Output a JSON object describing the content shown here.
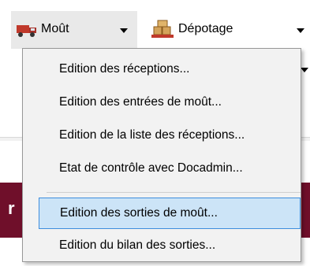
{
  "toolbar": {
    "mout": {
      "label": "Moût",
      "icon": "truck-icon"
    },
    "depotage": {
      "label": "Dépotage",
      "icon": "crates-icon"
    }
  },
  "background": {
    "band_text": "r"
  },
  "menu": {
    "items": [
      {
        "label": "Edition des réceptions..."
      },
      {
        "label": "Edition des entrées de moût..."
      },
      {
        "label": "Edition de la liste des réceptions..."
      },
      {
        "label": "Etat de contrôle avec Docadmin..."
      },
      {
        "label": "Edition des sorties de moût...",
        "selected": true
      },
      {
        "label": "Edition du bilan des sorties..."
      }
    ]
  },
  "colors": {
    "menu_bg": "#f2f2f2",
    "selection_bg": "#cce4f7",
    "selection_border": "#3e8ddd",
    "band": "#6f0f2a",
    "truck_red": "#c0392b"
  }
}
